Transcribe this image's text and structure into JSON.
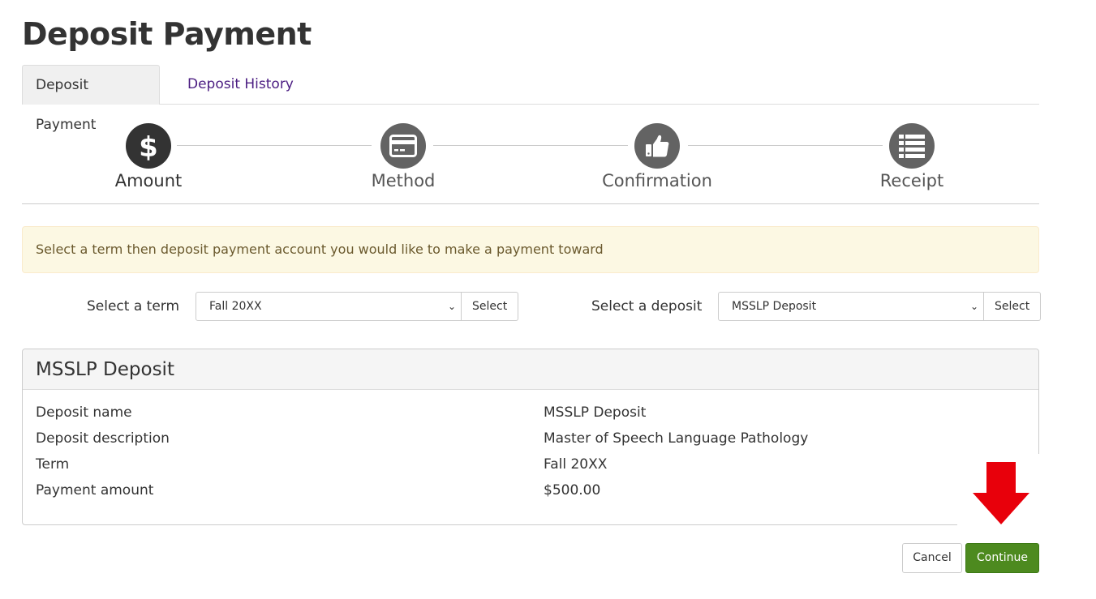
{
  "page": {
    "title": "Deposit Payment"
  },
  "tabs": [
    {
      "label": "Deposit Payment",
      "active": true
    },
    {
      "label": "Deposit History",
      "active": false
    }
  ],
  "steps": [
    {
      "label": "Amount",
      "icon": "dollar-icon",
      "active": true
    },
    {
      "label": "Method",
      "icon": "credit-card-icon",
      "active": false
    },
    {
      "label": "Confirmation",
      "icon": "thumbs-up-icon",
      "active": false
    },
    {
      "label": "Receipt",
      "icon": "list-icon",
      "active": false
    }
  ],
  "alert": {
    "text": "Select a term then deposit payment account you would like to make a payment toward"
  },
  "term_selector": {
    "label": "Select a term",
    "value": "Fall 20XX",
    "button_label": "Select"
  },
  "deposit_selector": {
    "label": "Select a deposit",
    "value": "MSSLP Deposit",
    "button_label": "Select"
  },
  "deposit_panel": {
    "heading": "MSSLP Deposit",
    "rows": [
      {
        "label": "Deposit name",
        "value": "MSSLP Deposit"
      },
      {
        "label": "Deposit description",
        "value": "Master of Speech Language Pathology"
      },
      {
        "label": "Term",
        "value": "Fall 20XX"
      },
      {
        "label": "Payment amount",
        "value": "$500.00"
      }
    ]
  },
  "actions": {
    "cancel_label": "Cancel",
    "continue_label": "Continue"
  },
  "colors": {
    "primary_button": "#4d8a1f",
    "tab_link": "#4b1d82",
    "alert_bg": "#fcf8e3",
    "annotation_arrow": "#e8000b"
  }
}
